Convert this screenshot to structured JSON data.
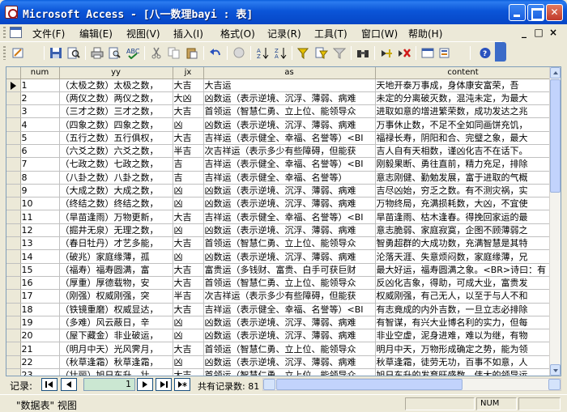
{
  "window": {
    "title": "Microsoft Access - [八一数理bayi : 表]"
  },
  "menu": {
    "items": [
      "文件(F)",
      "编辑(E)",
      "视图(V)",
      "插入(I)",
      "格式(O)",
      "记录(R)",
      "工具(T)",
      "窗口(W)",
      "帮助(H)"
    ],
    "mdi_controls": [
      "_",
      "□",
      "×"
    ]
  },
  "toolbar": {
    "buttons": [
      "view",
      "save",
      "search",
      "print",
      "print-preview",
      "spelling",
      "cut",
      "copy",
      "paste",
      "undo",
      "hyperlink",
      "sort-ascending",
      "sort-descending",
      "filter-by-selection",
      "filter-by-form",
      "apply-filter",
      "find",
      "new-record",
      "delete-record",
      "database-window",
      "new-object",
      "help"
    ]
  },
  "grid": {
    "columns": [
      "num",
      "yy",
      "jx",
      "as",
      "content"
    ],
    "current_row_index": 0,
    "rows": [
      {
        "num": "1",
        "yy": "（太极之数）太极之数，",
        "jx": "大吉",
        "as": "大吉运",
        "content": "天地开泰万事成，身体康安富荣，吾"
      },
      {
        "num": "2",
        "yy": "（两仪之数）两仪之数，",
        "jx": "大凶",
        "as": "凶数运（表示逆境、沉浮、薄弱、病难",
        "content": "未定的分离破灭数，混沌未定，为最大"
      },
      {
        "num": "3",
        "yy": "（三才之数）三才之数，",
        "jx": "大吉",
        "as": "首领运（智慧仁勇、立上位、能领导众",
        "content": "进取如意的增进繁荣数，成功发达之兆"
      },
      {
        "num": "4",
        "yy": "（四象之数）四象之数，",
        "jx": "凶",
        "as": "凶数运（表示逆境、沉浮、薄弱、病难",
        "content": "万事休止数，不足不全如同画饼充饥，"
      },
      {
        "num": "5",
        "yy": "（五行之数）五行俱权，",
        "jx": "大吉",
        "as": "吉祥运（表示健全、幸福、名誉等）<BI",
        "content": "福禄长寿，阴阳和合、完璧之象，最大"
      },
      {
        "num": "6",
        "yy": "（六爻之数）六爻之数，",
        "jx": "半吉",
        "as": "次吉祥运（表示多少有些障碍，但能获",
        "content": "吉人自有天相数，谨凶化吉不在话下。"
      },
      {
        "num": "7",
        "yy": "（七政之数）七政之数，",
        "jx": "吉",
        "as": "吉祥运（表示健全、幸福、名誉等）<BI",
        "content": "刚毅果断、勇往直前，精力充足，排除"
      },
      {
        "num": "8",
        "yy": "（八卦之数）八卦之数，",
        "jx": "吉",
        "as": "吉祥运（表示健全、幸福、名誉等）",
        "content": "意志刚健、勤勉发展，富于进取的气概"
      },
      {
        "num": "9",
        "yy": "（大成之数）大成之数，",
        "jx": "凶",
        "as": "凶数运（表示逆境、沉浮、薄弱、病难",
        "content": "吉尽凶始，穷乏之数。有不测灾祸，实"
      },
      {
        "num": "10",
        "yy": "（终结之数）终结之数，",
        "jx": "凶",
        "as": "凶数运（表示逆境、沉浮、薄弱、病难",
        "content": "万物终局，充满损耗数，大凶，不宜使"
      },
      {
        "num": "11",
        "yy": "（旱苗逢雨）万物更新，",
        "jx": "大吉",
        "as": "吉祥运（表示健全、幸福、名誉等）<BI",
        "content": "旱苗逢雨、枯木逢春。得挽回家运的最"
      },
      {
        "num": "12",
        "yy": "（掘井无泉）无理之数，",
        "jx": "凶",
        "as": "凶数运（表示逆境、沉浮、薄弱、病难",
        "content": "意志脆弱、家庭寂寞，企图不顾薄弱之"
      },
      {
        "num": "13",
        "yy": "（春日牡丹）才艺多能，",
        "jx": "大吉",
        "as": "首领运（智慧仁勇、立上位、能领导众",
        "content": "智勇超群的大成功数，充满智慧是其特"
      },
      {
        "num": "14",
        "yy": "（破兆）家庭缘薄，孤",
        "jx": "凶",
        "as": "凶数运（表示逆境、沉浮、薄弱、病难",
        "content": "沦落天涯、失意烦闷数，家庭缘薄，兄"
      },
      {
        "num": "15",
        "yy": "（福寿）福寿圆满，富",
        "jx": "大吉",
        "as": "富贵运（多钱财、富贵、白手可获巨财",
        "content": "最大好运，福寿圆满之象。<BR>诗曰：有"
      },
      {
        "num": "16",
        "yy": "（厚重）厚德载物，安",
        "jx": "大吉",
        "as": "首领运（智慧仁勇、立上位、能领导众",
        "content": "反凶化吉象，得助，可成大业，富贵发"
      },
      {
        "num": "17",
        "yy": "（刚强）权威刚强，突",
        "jx": "半吉",
        "as": "次吉祥运（表示多少有些障碍，但能获",
        "content": "权威刚强，有己无人，以至于与人不和"
      },
      {
        "num": "18",
        "yy": "（铁镜重磨）权威显达，",
        "jx": "大吉",
        "as": "吉祥运（表示健全、幸福、名誉等）<BI",
        "content": "有志竟成的内外吉数，一旦立志必排除"
      },
      {
        "num": "19",
        "yy": "（多难）风云蔽日，辛",
        "jx": "凶",
        "as": "凶数运（表示逆境、沉浮、薄弱、病难",
        "content": "有智谋，有兴大业博名利的实力，但每"
      },
      {
        "num": "20",
        "yy": "（屋下藏金）非业破运，",
        "jx": "凶",
        "as": "凶数运（表示逆境、沉浮、薄弱、病难",
        "content": "非业空虚，泥身进难，难以为继，有物"
      },
      {
        "num": "21",
        "yy": "（明月中天）光风霁月，",
        "jx": "大吉",
        "as": "首领运（智慧仁勇、立上位、能领导众",
        "content": "明月中天，万物形成确定之势，能为领"
      },
      {
        "num": "22",
        "yy": "（秋草逢霜）秋草逢霜，",
        "jx": "凶",
        "as": "凶数运（表示逆境、沉浮、薄弱、病难",
        "content": "秋草逢霜，徒劳无功，百事不如意，人"
      },
      {
        "num": "23",
        "yy": "（壮丽）旭日东升，壮",
        "jx": "大吉",
        "as": "首领运（智慧仁勇、立上位、能领导众",
        "content": "旭日东升的发育旺盛数，伟大的领导运"
      }
    ]
  },
  "navigation": {
    "label": "记录:",
    "current_record": "1",
    "total_label": "共有记录数: 81"
  },
  "status": {
    "text": "\"数据表\" 视图",
    "indicator": "NUM"
  }
}
